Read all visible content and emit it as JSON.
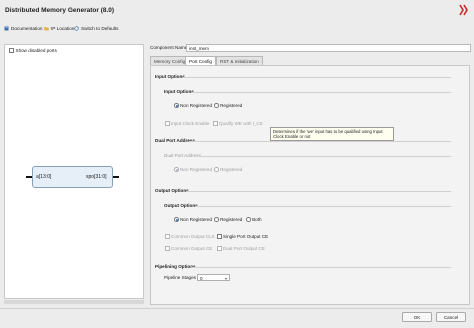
{
  "window": {
    "title": "Distributed Memory Generator (8.0)"
  },
  "toolbar": {
    "documentation": "Documentation",
    "ip_location": "IP Location",
    "switch_defaults": "Switch to Defaults"
  },
  "left": {
    "show_disabled_ports": "Show disabled ports",
    "port_left": "a[13:0]",
    "port_right": "spo[31:0]"
  },
  "component": {
    "label": "Component Name",
    "value": "inst_mem"
  },
  "tabs": [
    "Memory Config",
    "Port Config",
    "RST & Initialization"
  ],
  "input_options": {
    "section": "Input Options",
    "group": "Input Options",
    "non_registered": "Non Registered",
    "registered": "Registered",
    "input_clock_enable": "Input Clock Enable",
    "qualify": "Qualify WE with I_CE"
  },
  "tooltip": {
    "text": "Determines if the 'we' input has to be qualified using Input Clock Enable or not"
  },
  "dual_port": {
    "section": "Dual Port Address",
    "group": "Dual Port Address",
    "non_registered": "Non Registered",
    "registered": "Registered"
  },
  "output_options": {
    "section": "Output Options",
    "group": "Output Options",
    "non_registered": "Non Registered",
    "registered": "Registered",
    "both": "Both",
    "common_output_clk": "Common Output CLK",
    "single_port_output_ce": "Single Port Output CE",
    "common_output_ce": "Common Output CE",
    "dual_port_output_ce": "Dual Port Output CE"
  },
  "pipelining": {
    "section": "Pipelining Options",
    "label": "Pipeline Stages",
    "value": "0"
  },
  "buttons": {
    "ok": "OK",
    "cancel": "Cancel"
  }
}
